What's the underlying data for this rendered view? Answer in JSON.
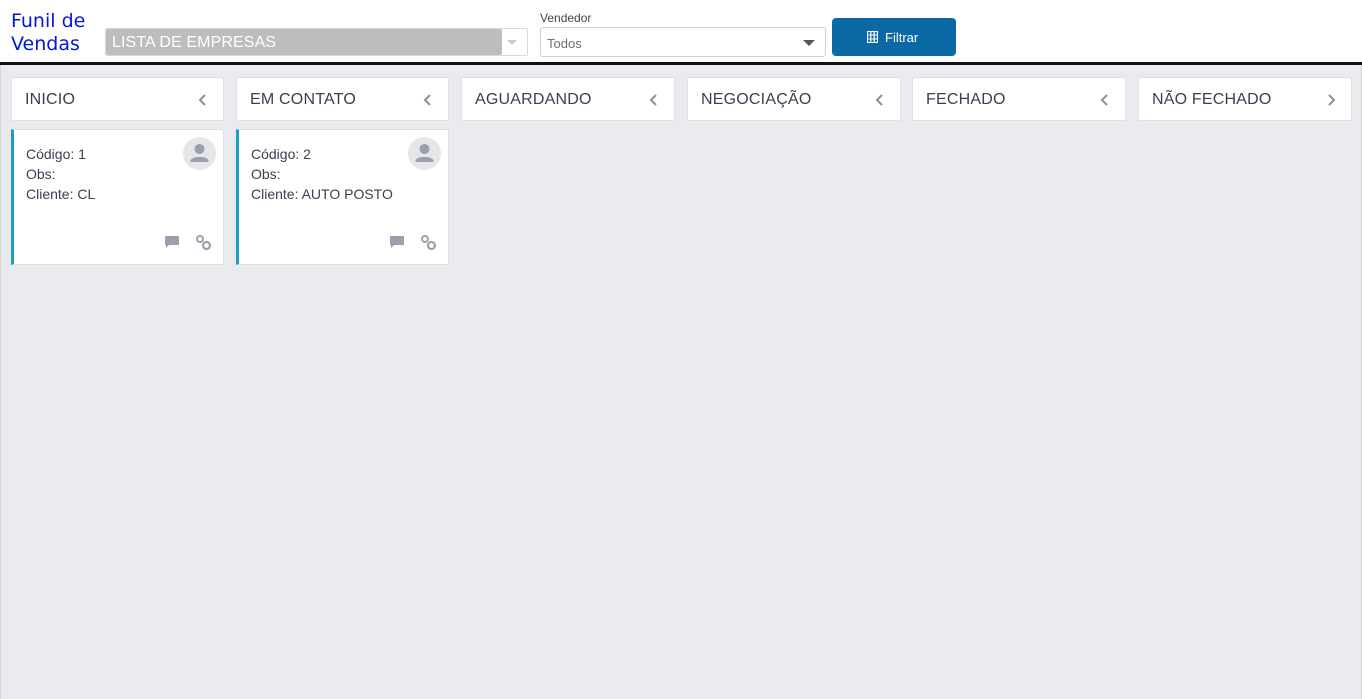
{
  "header": {
    "title_line1": "Funil de",
    "title_line2": "Vendas",
    "company_select": {
      "value": "LISTA DE EMPRESAS"
    },
    "vendedor": {
      "label": "Vendedor",
      "value": "Todos"
    },
    "filter_button": {
      "label": "Filtrar"
    }
  },
  "columns": [
    {
      "title": "INICIO",
      "chevron": "chevron-left-icon"
    },
    {
      "title": "EM CONTATO",
      "chevron": "chevron-left-icon"
    },
    {
      "title": "AGUARDANDO",
      "chevron": "chevron-left-icon"
    },
    {
      "title": "NEGOCIAÇÃO",
      "chevron": "chevron-left-icon"
    },
    {
      "title": "FECHADO",
      "chevron": "chevron-left-icon"
    },
    {
      "title": "NÃO FECHADO",
      "chevron": "chevron-right-icon"
    }
  ],
  "cards": [
    {
      "codigo": "Código: 1",
      "obs": "Obs:",
      "cliente": "Cliente: CL"
    },
    {
      "codigo": "Código: 2",
      "obs": "Obs:",
      "cliente": "Cliente: AUTO POSTO"
    }
  ],
  "colors": {
    "title_blue": "#0018d6",
    "button_blue": "#0b6aa5",
    "card_accent": "#1aa0c4",
    "board_bg": "#e9ebef"
  }
}
